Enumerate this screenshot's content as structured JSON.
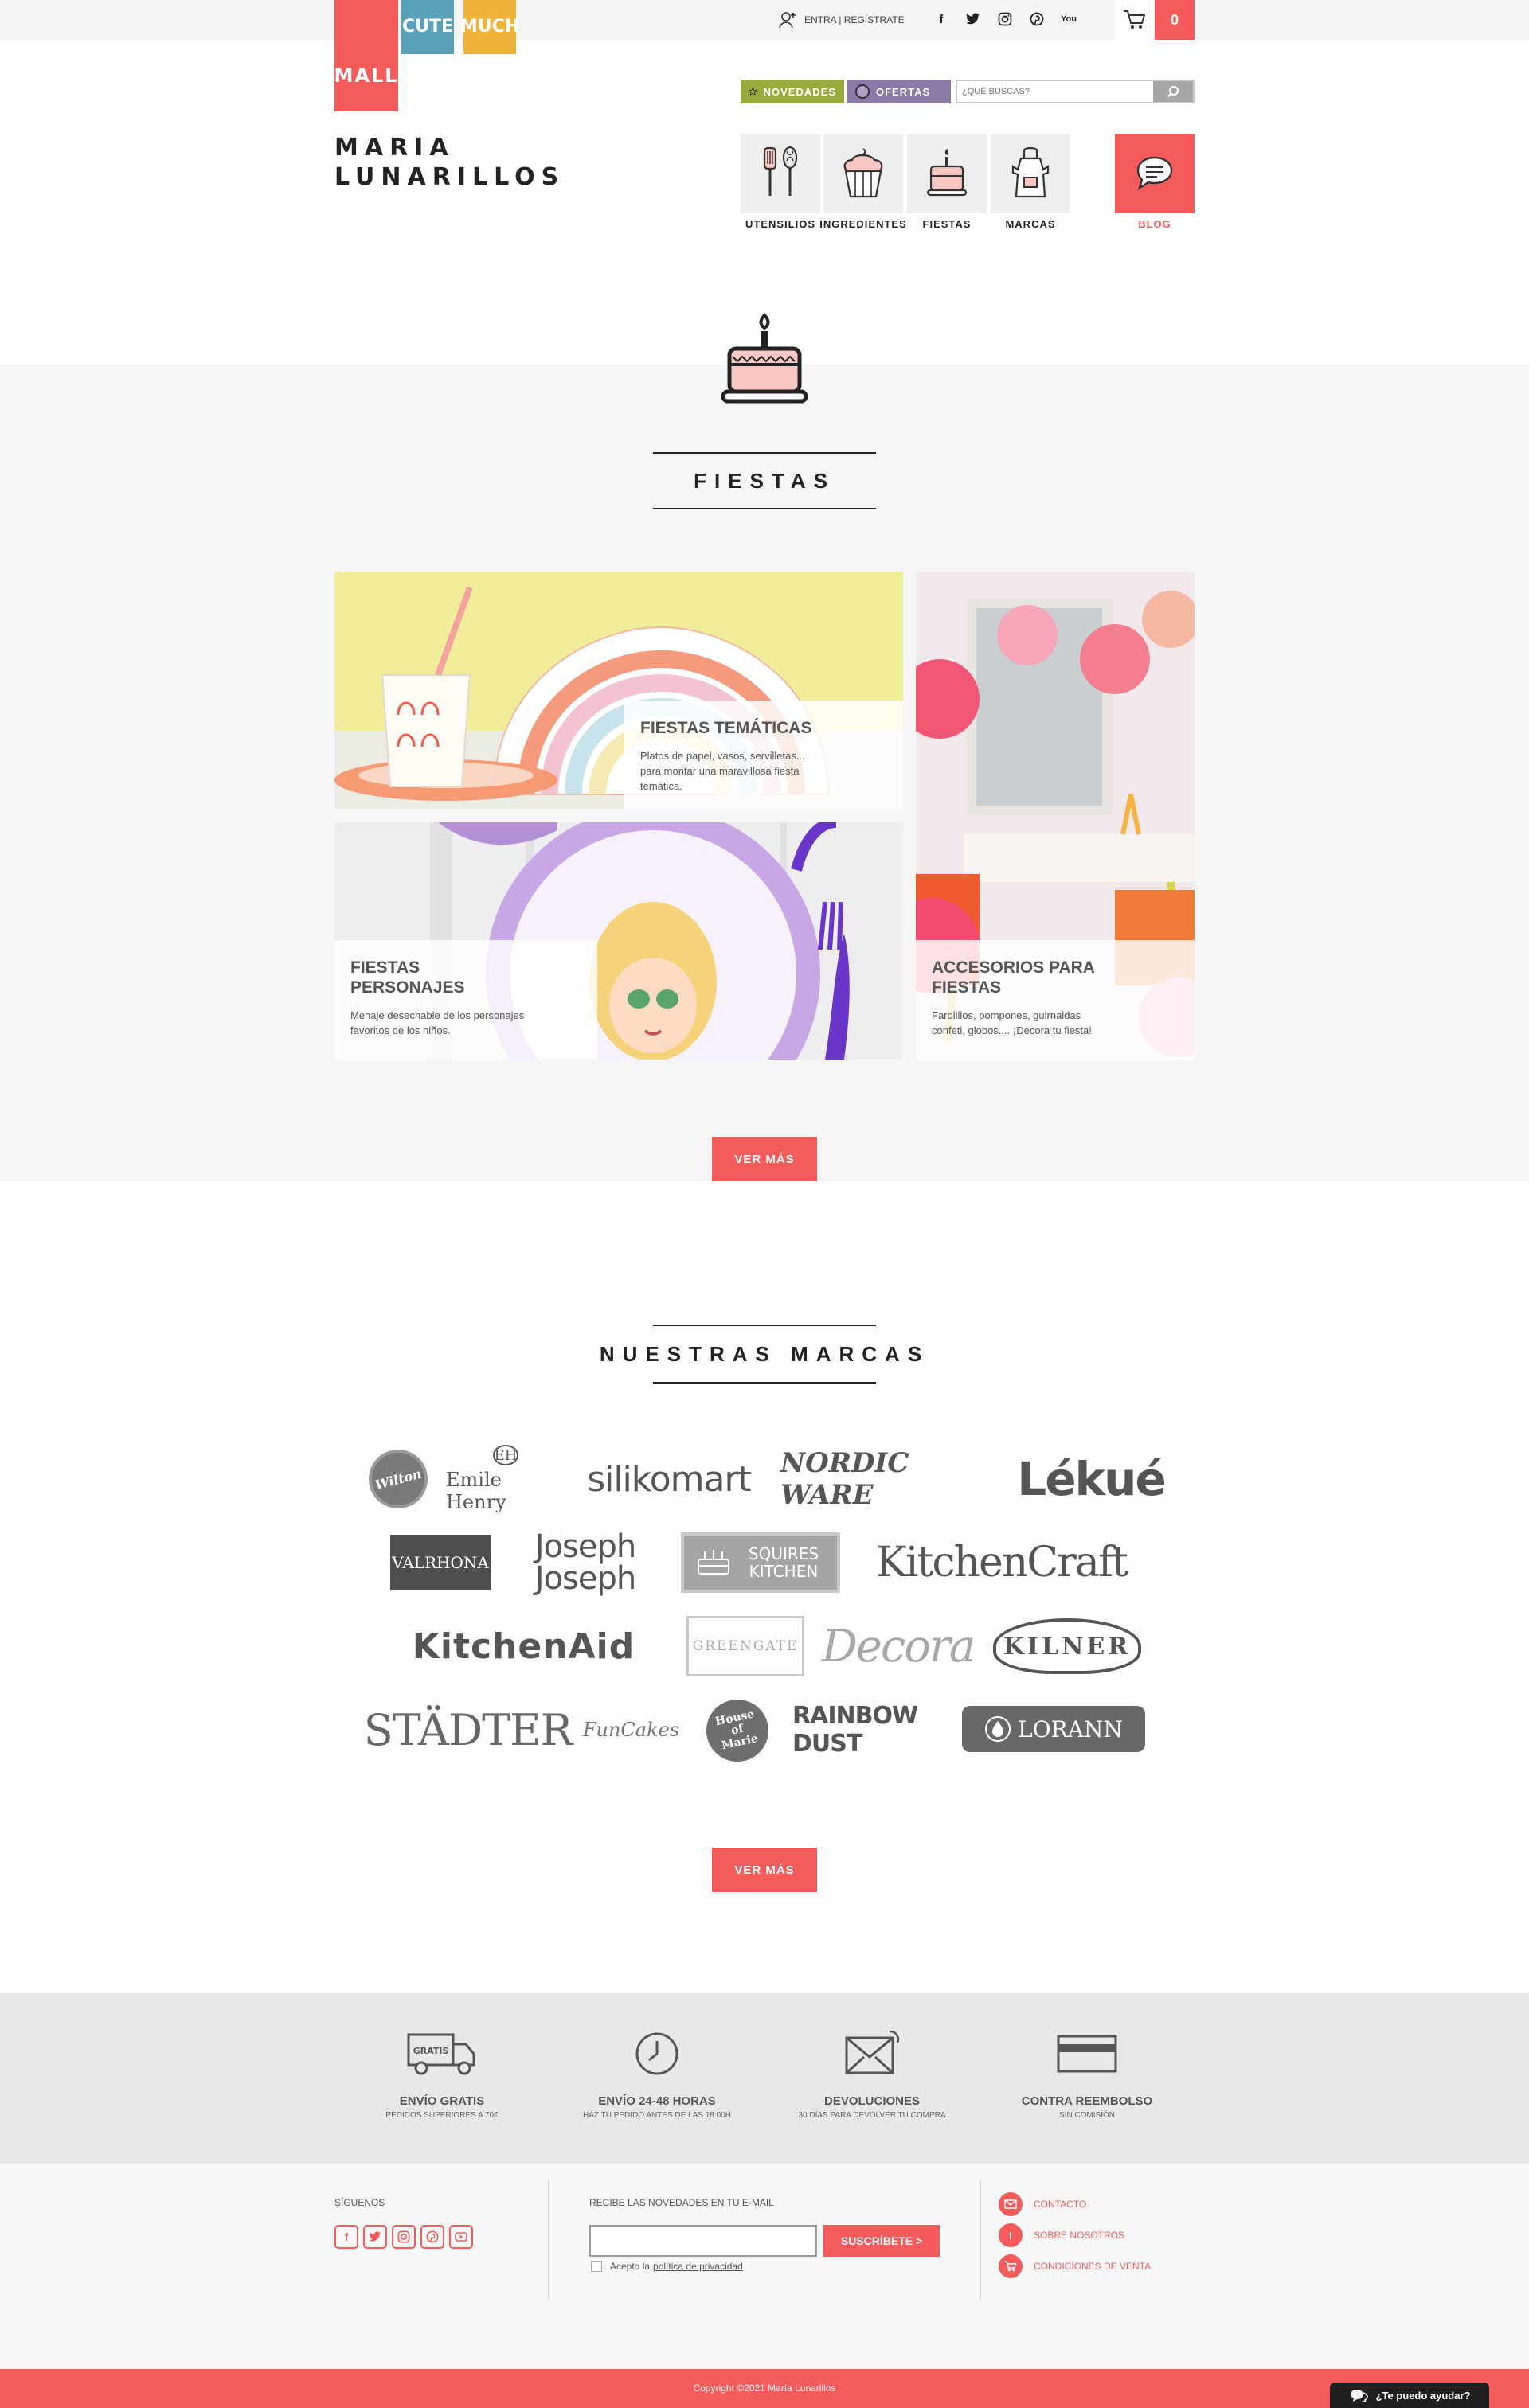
{
  "header": {
    "logo_tiles": {
      "mall": "MALL",
      "cute": "CUTE",
      "much": "MUCH"
    },
    "login_label": "ENTRA | REGÍSTRATE",
    "cart_count": "0",
    "brand_line1": "MARIA",
    "brand_line2": "LUNARILLOS"
  },
  "toolbar": {
    "novedades_label": "NOVEDADES",
    "ofertas_label": "OFERTAS",
    "search_placeholder": "¿QUÉ BUSCAS?"
  },
  "categories": [
    {
      "label": "UTENSILIOS",
      "icon": "utensils-icon"
    },
    {
      "label": "INGREDIENTES",
      "icon": "cupcake-icon"
    },
    {
      "label": "FIESTAS",
      "icon": "cake-icon"
    },
    {
      "label": "MARCAS",
      "icon": "apron-icon"
    }
  ],
  "blog_label": "BLOG",
  "fiestas": {
    "title": "FIESTAS",
    "cards": [
      {
        "title": "FIESTAS TEMÁTICAS",
        "text": "Platos de papel, vasos, servilletas... para montar una maravillosa fiesta temática."
      },
      {
        "title": "FIESTAS PERSONAJES",
        "text": "Menaje desechable de los personajes favoritos de los niños."
      },
      {
        "title": "ACCESORIOS PARA FIESTAS",
        "text": "Farolillos, pompones, guirnaldas confeti, globos.... ¡Decora tu fiesta!"
      }
    ],
    "more_label": "VER MÁS"
  },
  "marcas": {
    "title": "NUESTRAS MARCAS",
    "brands": [
      "Wilton",
      "Emile Henry",
      "silikomart",
      "NORDIC WARE",
      "Lékué",
      "VALRHONA",
      "Joseph Joseph",
      "SQUIRES KITCHEN",
      "KitchenCraft",
      "KitchenAid",
      "GREENGATE",
      "Decora",
      "KILNER",
      "STÄDTER",
      "FunCakes",
      "House of Marie",
      "RAINBOW DUST",
      "LORANN"
    ],
    "more_label": "VER MÁS"
  },
  "benefits": [
    {
      "title": "ENVÍO GRATIS",
      "sub": "PEDIDOS SUPERIORES A 70€",
      "badge": "GRATIS"
    },
    {
      "title": "ENVÍO 24-48 HORAS",
      "sub": "HAZ TU PEDIDO ANTES DE LAS 18:00H"
    },
    {
      "title": "DEVOLUCIONES",
      "sub": "30 DÍAS PARA DEVOLVER TU COMPRA"
    },
    {
      "title": "CONTRA REEMBOLSO",
      "sub": "SIN COMISIÓN"
    }
  ],
  "footer": {
    "follow_label": "SÍGUENOS",
    "newsletter_label": "RECIBE LAS NOVEDADES EN TU E-MAIL",
    "subscribe_label": "SUSCRÍBETE >",
    "privacy_prefix": "Acepto la",
    "privacy_link": "política de privacidad",
    "links": [
      "CONTACTO",
      "SOBRE NOSOTROS",
      "CONDICIONES DE VENTA"
    ],
    "copyright": "Copyright ©2021 María Lunarillos",
    "chat_label": "¿Te puedo ayudar?"
  },
  "colors": {
    "accent": "#f55b5b",
    "novedades": "#9aaa3f",
    "ofertas": "#8b79a8",
    "cute": "#5aa0b9",
    "much": "#f0b33a"
  }
}
